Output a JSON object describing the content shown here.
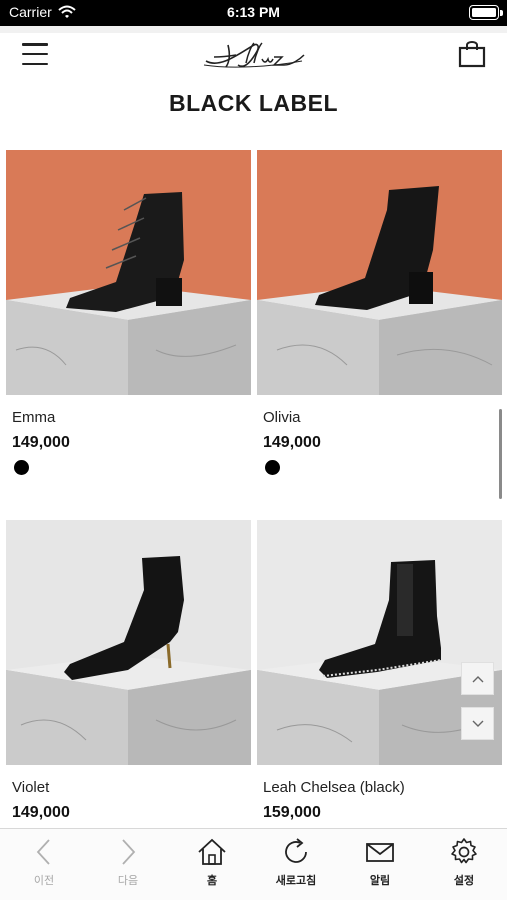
{
  "status_bar": {
    "carrier": "Carrier",
    "time": "6:13 PM"
  },
  "header": {
    "logo_text": "Alluz",
    "title": "BLACK LABEL"
  },
  "products": [
    {
      "name": "Emma",
      "price": "149,000",
      "swatch_color": "#000000",
      "background": "#d97a57"
    },
    {
      "name": "Olivia",
      "price": "149,000",
      "swatch_color": "#000000",
      "background": "#d97a57"
    },
    {
      "name": "Violet",
      "price": "149,000",
      "background": "#e6e6e6"
    },
    {
      "name": "Leah Chelsea (black)",
      "price": "159,000",
      "background": "#e9e9e9"
    }
  ],
  "tabbar": {
    "items": [
      {
        "label": "이전",
        "icon": "chevron-left-icon",
        "enabled": false
      },
      {
        "label": "다음",
        "icon": "chevron-right-icon",
        "enabled": false
      },
      {
        "label": "홈",
        "icon": "home-icon",
        "enabled": true
      },
      {
        "label": "새로고침",
        "icon": "refresh-icon",
        "enabled": true
      },
      {
        "label": "알림",
        "icon": "mail-icon",
        "enabled": true
      },
      {
        "label": "설정",
        "icon": "gear-icon",
        "enabled": true
      }
    ]
  },
  "colors": {
    "status_bar": "#000000",
    "text": "#111111",
    "accent_orange": "#d97a57",
    "marble": "#cfcfcf"
  }
}
